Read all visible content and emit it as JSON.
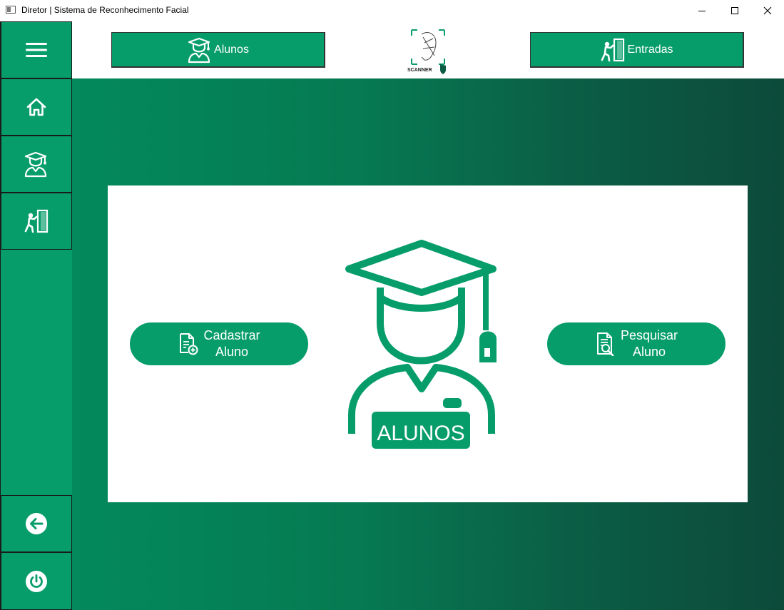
{
  "window": {
    "title": "Diretor | Sistema de Reconhecimento Facial",
    "controls": [
      "minimize-icon",
      "maximize-icon",
      "close-icon"
    ]
  },
  "sidebar": {
    "items": [
      {
        "icon": "menu-icon"
      },
      {
        "icon": "home-icon"
      },
      {
        "icon": "student-icon"
      },
      {
        "icon": "entrance-icon"
      },
      {
        "icon": "back-arrow-icon"
      },
      {
        "icon": "power-icon"
      }
    ]
  },
  "topbar": {
    "alunos_label": "Alunos",
    "entradas_label": "Entradas",
    "logo_text": "SCANNER"
  },
  "main": {
    "hero_label": "ALUNOS",
    "cadastrar_line1": "Cadastrar",
    "cadastrar_line2": "Aluno",
    "pesquisar_line1": "Pesquisar",
    "pesquisar_line2": "Aluno"
  },
  "colors": {
    "accent": "#079d6b",
    "gradient_start": "#03895c",
    "gradient_end": "#0c4a3a",
    "card": "#ffffff"
  }
}
